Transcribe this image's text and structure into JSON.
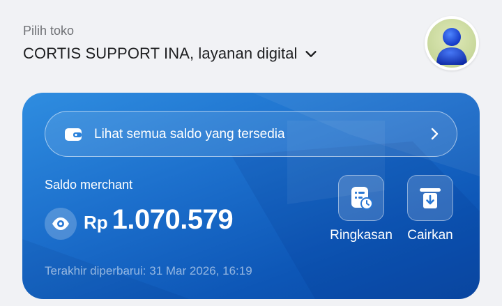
{
  "header": {
    "store_label": "Pilih toko",
    "store_name": "CORTIS SUPPORT INA, layanan digital"
  },
  "card": {
    "all_balance_link": "Lihat semua saldo yang tersedia",
    "merchant_label": "Saldo merchant",
    "currency": "Rp",
    "amount": "1.070.579",
    "last_updated": "Terakhir diperbarui: 31 Mar 2026, 16:19",
    "actions": [
      {
        "label": "Ringkasan",
        "icon": "summary-clock-icon"
      },
      {
        "label": "Cairkan",
        "icon": "withdraw-icon"
      }
    ]
  },
  "colors": {
    "card_start": "#2f8de0",
    "card_end": "#0b4aa6",
    "text_dark": "#1d1e20",
    "text_muted": "#6f7175",
    "background": "#f1f2f5"
  }
}
